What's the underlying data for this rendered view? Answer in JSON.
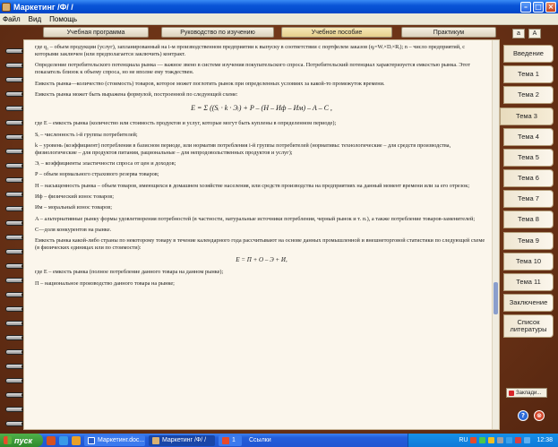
{
  "window": {
    "title": "Маркетинг /Ф/ /"
  },
  "menu": [
    "Файл",
    "Вид",
    "Помощь"
  ],
  "top_tabs": [
    "Учебная программа",
    "Руководство по изучению",
    "Учебное пособие",
    "Практикум"
  ],
  "active_top_tab": "Учебное пособие",
  "font_buttons": [
    "a",
    "A"
  ],
  "side_nav": [
    "Введение",
    "Тема 1",
    "Тема 2",
    "Тема 3",
    "Тема 4",
    "Тема 5",
    "Тема 6",
    "Тема 7",
    "Тема 8",
    "Тема 9",
    "Тема 10",
    "Тема 11",
    "Заключение",
    "Список литературы"
  ],
  "active_side_nav": "Тема 3",
  "bookmarks_label": "Заклади...",
  "help_button": "?",
  "exit_button": "⊗",
  "content": {
    "p1": "где q₁ – объем продукции (услуг), запланированный на i-м производственном предприятии к выпуску в соответствии с портфелем заказов (qᵢ=Wᵢ×Dᵢ×Rᵢ); n – число предприятий, с которыми заключен (или предполагается заключить) контракт.",
    "p2": "Определение потребительского потенциала рынка — важное звено в системе изучения покупательского спроса. Потребительский потенциал характеризуется емкостью рынка. Этот показатель близок к объему спроса, но не вполне ему тождествен.",
    "p3": "Емкость рынка—количество (стоимость) товаров, которое может поглотить рынок при определенных условиях за какой-то промежуток времени.",
    "p4": "Емкость рынка может быть выражена формулой, построенной по следующей схеме:",
    "formula1": "E = Σ ((Sᵢ · k · Эᵢ) + P – (H – Иф – Им) – A – C ,",
    "p5": "где E – емкость рынка (количество или стоимость продуктов и услуг, которые могут быть куплены в определенном периоде);",
    "p6": "Sᵢ – численность i-й группы потребителей;",
    "p7": "k – уровень (коэффициент) потребления в базисном периоде, или норматив потребления i-й группы потребителей (нормативы: технологические – для средств производства, физиологические – для продуктов питания, рациональные – для непродовольственных продуктов и услуг);",
    "p8": "Эᵢ – коэффициенты эластичности спроса от цен и доходов;",
    "p9": "P – объем нормального страхового резерва товаров;",
    "p10": "H – насыщенность рынка – объем товаров, имеющихся в домашнем хозяйстве населения, или средств производства на предприятиях на данный момент времени или за его отрезок;",
    "p11": "Иф – физический износ товаров;",
    "p12": "Им – моральный износ товаров;",
    "p13": "A – альтернативные рынку формы удовлетворения потребностей (в частности, натуральные источники потребления, черный рынок и т. п.), а также потребление товаров-заменителей;",
    "p14": "C—доля конкурентов на рынке.",
    "p15": "Емкость рынка какой-либо страны по некоторому товару в течение календарного года рассчитывают на основе данных промышленной и внешнеторговой статистики по следующей схеме (в физических единицах или по стоимости):",
    "formula2": "E = П + О – Э + И,",
    "p16": "где E – емкость рынка (полное потребление данного товара на данном рынке);",
    "p17": "П – национальное производство данного товара на рынке;"
  },
  "taskbar": {
    "start": "пуск",
    "tasks": [
      "Маркетинг.doc...",
      "Маркетинг /Ф/ /",
      "1",
      "Ссылки"
    ],
    "tray_lang": "RU",
    "clock": "12:38"
  },
  "colors": {
    "frame": "#6a3418",
    "page": "#fbf6ec",
    "xp_blue": "#245edb",
    "active_tab": "#e6cf8c"
  }
}
